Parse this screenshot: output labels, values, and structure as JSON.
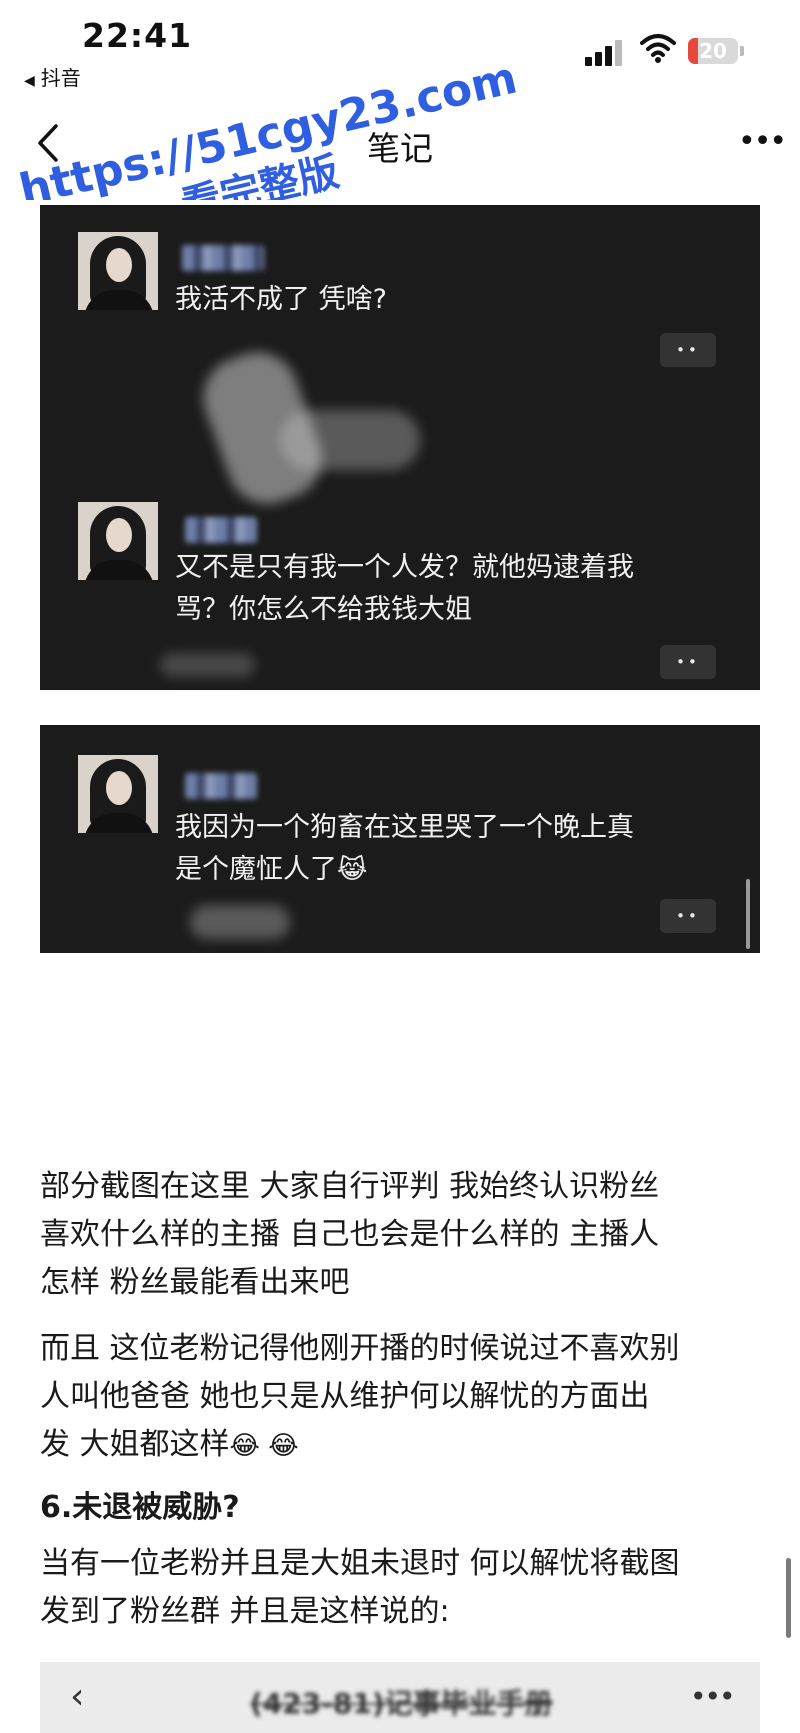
{
  "status_bar": {
    "time": "22:41",
    "back_app": "抖音",
    "battery": "20",
    "battery_level_percent": 20
  },
  "nav": {
    "title": "笔记",
    "more": "•••"
  },
  "watermark": {
    "line1": "https://51cgy23.com",
    "line2": "看完整版"
  },
  "chat_screenshots": {
    "messages": [
      {
        "text": "我活不成了 凭啥?"
      },
      {
        "text_line1": "又不是只有我一个人发？就他妈逮着我",
        "text_line2": "骂？你怎么不给我钱大姐"
      },
      {
        "text_line1": "我因为一个狗畜在这里哭了一个晚上真",
        "text_line2": "是个魔怔人了"
      }
    ],
    "dots_label": "••",
    "emoji_cry": "😹"
  },
  "article": {
    "p1_line1": "部分截图在这里 大家自行评判 我始终认识粉丝",
    "p1_line2": "喜欢什么样的主播 自己也会是什么样的 主播人",
    "p1_line3": "怎样 粉丝最能看出来吧",
    "p2_line1": "而且 这位老粉记得他刚开播的时候说过不喜欢别",
    "p2_line2": "人叫他爸爸 她也只是从维护何以解忧的方面出",
    "p2_line3": "发 大姐都这样",
    "p2_emoji": "😂 😂",
    "heading": "6.未退被威胁?",
    "p3_line1": "当有一位老粉并且是大姐未退时 何以解忧将截图",
    "p3_line2": "发到了粉丝群 并且是这样说的:"
  },
  "embedded_chat_header": {
    "back": "‹",
    "title": "(423-81)记事毕业手册",
    "more": "•••"
  }
}
